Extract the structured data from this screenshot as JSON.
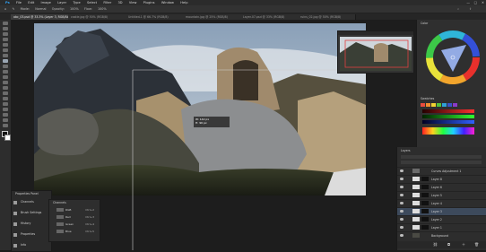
{
  "menubar": {
    "items": [
      "Ps",
      "File",
      "Edit",
      "Image",
      "Layer",
      "Type",
      "Select",
      "Filter",
      "3D",
      "View",
      "Plugins",
      "Window",
      "Help"
    ]
  },
  "optionsbar": {
    "items": [
      "Mode:",
      "Normal",
      "Opacity:",
      "100%",
      "Flow:",
      "100%"
    ]
  },
  "tabs": [
    {
      "label": "abc_03.psd @ 33.3% (Layer 3, RGB/8#)",
      "active": true
    },
    {
      "label": "castle.jpg @ 50% (RGB/8)",
      "active": false
    },
    {
      "label": "Untitled-1 @ 66.7% (RGB/8)",
      "active": false
    },
    {
      "label": "mountain.jpg @ 25% (RGB/8)",
      "active": false
    },
    {
      "label": "Layer-07.psd @ 33% (RGB/8)",
      "active": false
    },
    {
      "label": "ruins_02.jpg @ 50% (RGB/8)",
      "active": false
    }
  ],
  "dock": {
    "color_tab": "Color",
    "swatches_tab": "Swatches",
    "layers_tab": "Layers"
  },
  "layers": [
    {
      "name": "Curves Adjustment 1",
      "selected": false
    },
    {
      "name": "Layer 8",
      "selected": false
    },
    {
      "name": "Layer 6",
      "selected": false
    },
    {
      "name": "Layer 5",
      "selected": false
    },
    {
      "name": "Layer 4",
      "selected": false
    },
    {
      "name": "Layer 3",
      "selected": true
    },
    {
      "name": "Layer 2",
      "selected": false
    },
    {
      "name": "Layer 1",
      "selected": false
    },
    {
      "name": "Background",
      "selected": false
    }
  ],
  "left_panels": {
    "header": "Properties Panel",
    "items": [
      "Channels",
      "Brush Settings",
      "History",
      "Properties",
      "Info"
    ]
  },
  "channels": {
    "title": "Channels",
    "rows": [
      {
        "name": "RGB",
        "shortcut": "Ctrl+2"
      },
      {
        "name": "Red",
        "shortcut": "Ctrl+3"
      },
      {
        "name": "Green",
        "shortcut": "Ctrl+4"
      },
      {
        "name": "Blue",
        "shortcut": "Ctrl+5"
      }
    ]
  },
  "measurement_tooltip": {
    "line1": "W: 142 px",
    "line2": "H: 96 px"
  },
  "colors": {
    "accent": "#3d8ee0",
    "swatch_row1": [
      "#e84c3d",
      "#f08c2e",
      "#f2d232",
      "#52c23a",
      "#2fa0d8",
      "#3a54c8",
      "#8a3ac8"
    ],
    "swatch_row2": [
      "#ff6c7e",
      "#ffb36a",
      "#fff07e",
      "#8aff8a",
      "#7ad8ff",
      "#7e9aff",
      "#d49aff"
    ]
  }
}
